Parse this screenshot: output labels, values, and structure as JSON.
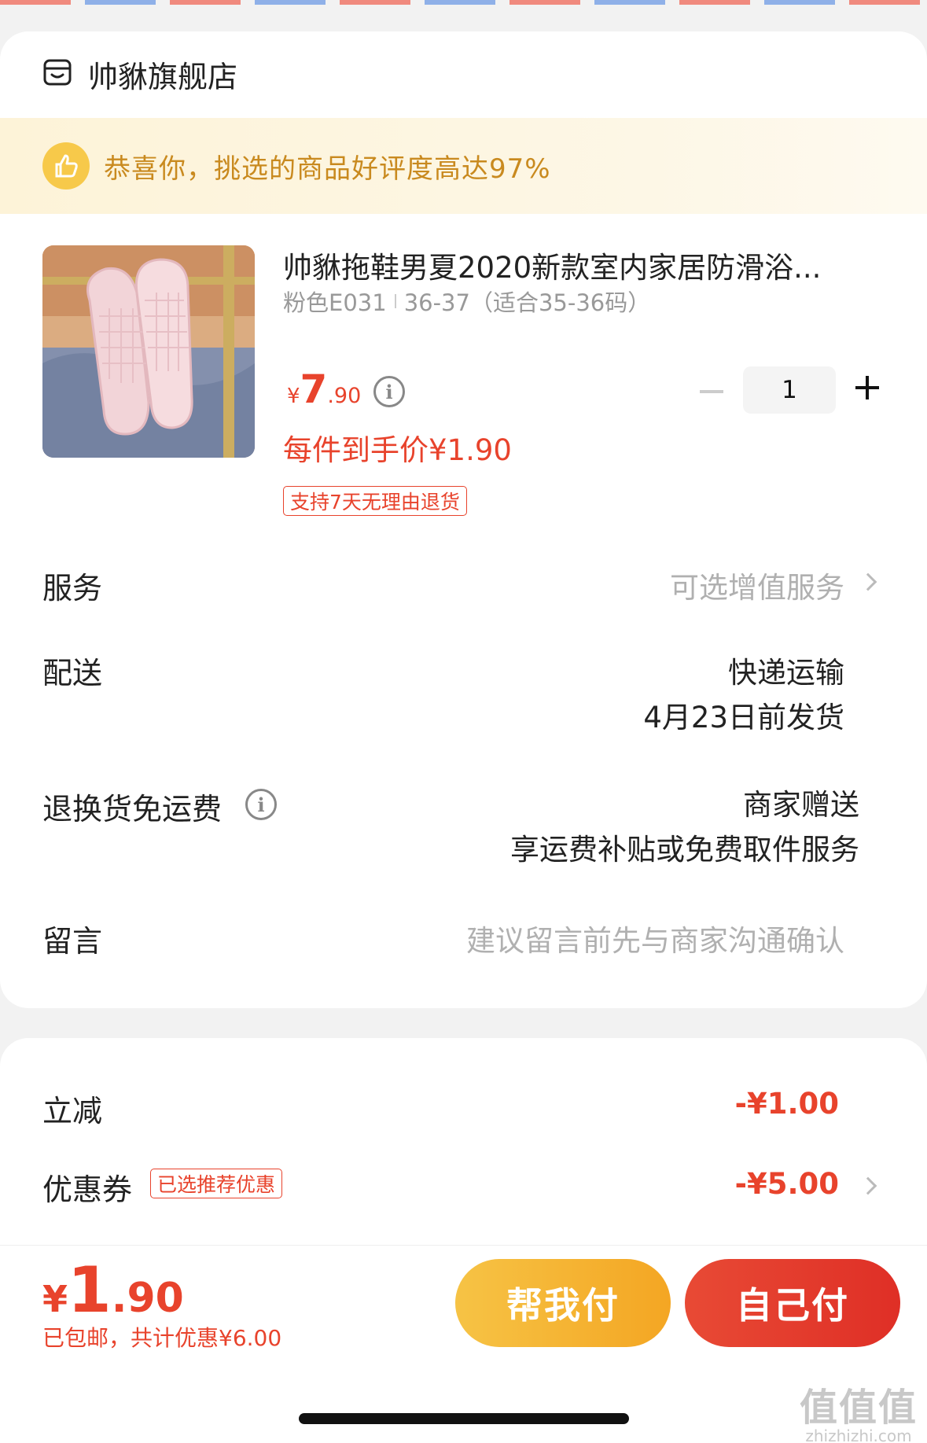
{
  "store": {
    "name": "帅貅旗舰店",
    "icon": "store-icon"
  },
  "banner": {
    "text": "恭喜你，挑选的商品好评度高达97%",
    "icon": "thumbs-up-icon"
  },
  "product": {
    "title": "帅貅拖鞋男夏2020新款室内家居防滑浴...",
    "spec_color": "粉色E031",
    "spec_size": "36-37（适合35-36码）",
    "price_symbol": "¥",
    "price_int": "7",
    "price_dec": ".90",
    "per_price": "每件到手价¥1.90",
    "return_badge": "支持7天无理由退货",
    "quantity": "1"
  },
  "rows": {
    "service_label": "服务",
    "service_value": "可选增值服务",
    "delivery_label": "配送",
    "delivery_method": "快递运输",
    "delivery_date": "4月23日前发货",
    "return_label": "退换货免运费",
    "return_value1": "商家赠送",
    "return_value2": "享运费补贴或免费取件服务",
    "message_label": "留言",
    "message_placeholder": "建议留言前先与商家沟通确认"
  },
  "discounts": {
    "instant_label": "立减",
    "instant_value": "-¥1.00",
    "coupon_label": "优惠券",
    "coupon_badge": "已选推荐优惠",
    "coupon_value": "-¥5.00"
  },
  "checkout": {
    "total_symbol": "¥",
    "total_int": "1",
    "total_dec": ".90",
    "total_sub": "已包邮，共计优惠¥6.00",
    "help_pay": "帮我付",
    "self_pay": "自己付"
  },
  "watermark": {
    "big": "值值值",
    "small": "zhizhizhi.com"
  },
  "colors": {
    "accent_red": "#e8432c",
    "gold": "#f4a623",
    "banner_text": "#c98a1f"
  }
}
